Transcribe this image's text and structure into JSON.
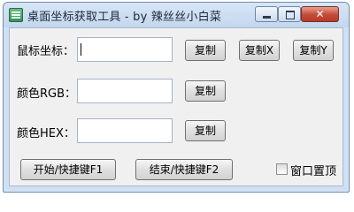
{
  "window": {
    "title": "桌面坐标获取工具 - by 辣丝丝小白菜"
  },
  "mouse": {
    "label": "鼠标坐标：",
    "value": "",
    "copy_label": "复制",
    "copy_x_label": "复制X",
    "copy_y_label": "复制Y"
  },
  "rgb": {
    "label": "颜色RGB：",
    "value": "",
    "copy_label": "复制"
  },
  "hex": {
    "label": "颜色HEX：",
    "value": "",
    "copy_label": "复制"
  },
  "footer": {
    "start_label": "开始/快捷键F1",
    "stop_label": "结束/快捷键F2",
    "topmost_label": "窗口置顶",
    "topmost_checked": false
  }
}
